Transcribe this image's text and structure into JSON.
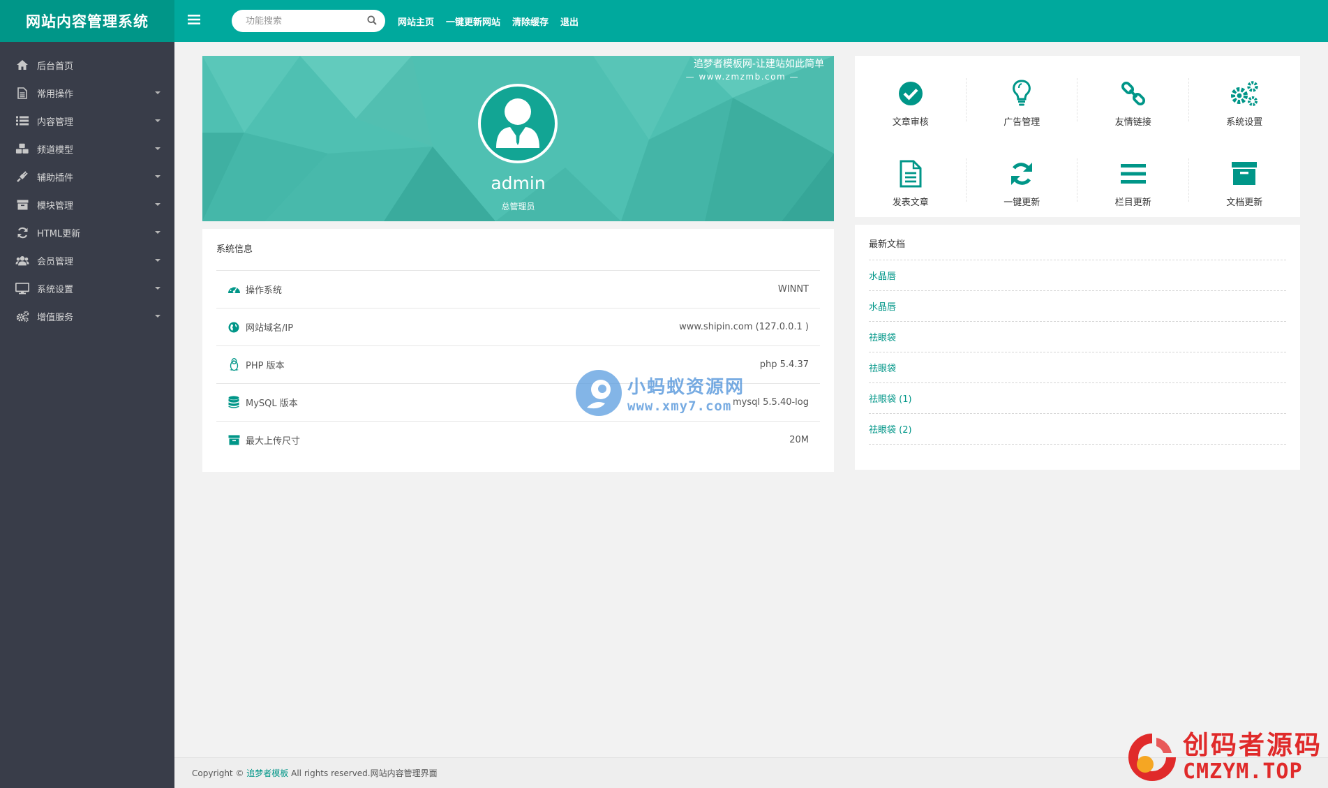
{
  "app": {
    "title": "网站内容管理系统"
  },
  "header": {
    "search_placeholder": "功能搜索",
    "links": [
      "网站主页",
      "一键更新网站",
      "清除缓存",
      "退出"
    ]
  },
  "sidebar": {
    "items": [
      {
        "label": "后台首页",
        "icon": "home-icon",
        "has_caret": false
      },
      {
        "label": "常用操作",
        "icon": "file-text-icon",
        "has_caret": true
      },
      {
        "label": "内容管理",
        "icon": "list-icon",
        "has_caret": true
      },
      {
        "label": "频道模型",
        "icon": "cubes-icon",
        "has_caret": true
      },
      {
        "label": "辅助插件",
        "icon": "plug-icon",
        "has_caret": true
      },
      {
        "label": "模块管理",
        "icon": "archive-icon",
        "has_caret": true
      },
      {
        "label": "HTML更新",
        "icon": "refresh-icon",
        "has_caret": true
      },
      {
        "label": "会员管理",
        "icon": "users-icon",
        "has_caret": true
      },
      {
        "label": "系统设置",
        "icon": "desktop-icon",
        "has_caret": true
      },
      {
        "label": "增值服务",
        "icon": "gears-icon",
        "has_caret": true
      }
    ]
  },
  "banner": {
    "slogan": "追梦者模板网-让建站如此简单",
    "url": "— www.zmzmb.com —",
    "user_name": "admin",
    "user_role": "总管理员"
  },
  "system_info": {
    "title": "系统信息",
    "rows": [
      {
        "label": "操作系统",
        "value": "WINNT",
        "icon": "dashboard-icon"
      },
      {
        "label": "网站域名/IP",
        "value": "www.shipin.com (127.0.0.1 )",
        "icon": "globe-icon"
      },
      {
        "label": "PHP 版本",
        "value": "php 5.4.37",
        "icon": "linux-icon"
      },
      {
        "label": "MySQL 版本",
        "value": "mysql 5.5.40-log",
        "icon": "database-icon"
      },
      {
        "label": "最大上传尺寸",
        "value": "20M",
        "icon": "archive-icon"
      }
    ]
  },
  "quick_actions": [
    {
      "label": "文章审核",
      "icon": "check-circle-icon"
    },
    {
      "label": "广告管理",
      "icon": "lightbulb-icon"
    },
    {
      "label": "友情链接",
      "icon": "chain-link-icon"
    },
    {
      "label": "系统设置",
      "icon": "gears-icon"
    },
    {
      "label": "发表文章",
      "icon": "file-text-icon"
    },
    {
      "label": "一键更新",
      "icon": "refresh-icon"
    },
    {
      "label": "栏目更新",
      "icon": "bars-icon"
    },
    {
      "label": "文档更新",
      "icon": "archive-icon"
    }
  ],
  "latest_docs": {
    "title": "最新文档",
    "items": [
      "水晶唇",
      "水晶唇",
      "祛眼袋",
      "祛眼袋",
      "祛眼袋 (1)",
      "祛眼袋 (2)"
    ]
  },
  "footer": {
    "prefix": "Copyright ©",
    "link": "追梦者模板",
    "suffix": "All rights reserved.网站内容管理界面"
  },
  "watermarks": {
    "center_line1": "小蚂蚁资源网",
    "center_line2": "www.xmy7.com",
    "corner_line1": "创码者源码",
    "corner_line2": "CMZYM.TOP"
  },
  "colors": {
    "primary": "#009688",
    "header": "#00a99d",
    "sidebar": "#393d49",
    "banner": "#4fc0b2"
  }
}
